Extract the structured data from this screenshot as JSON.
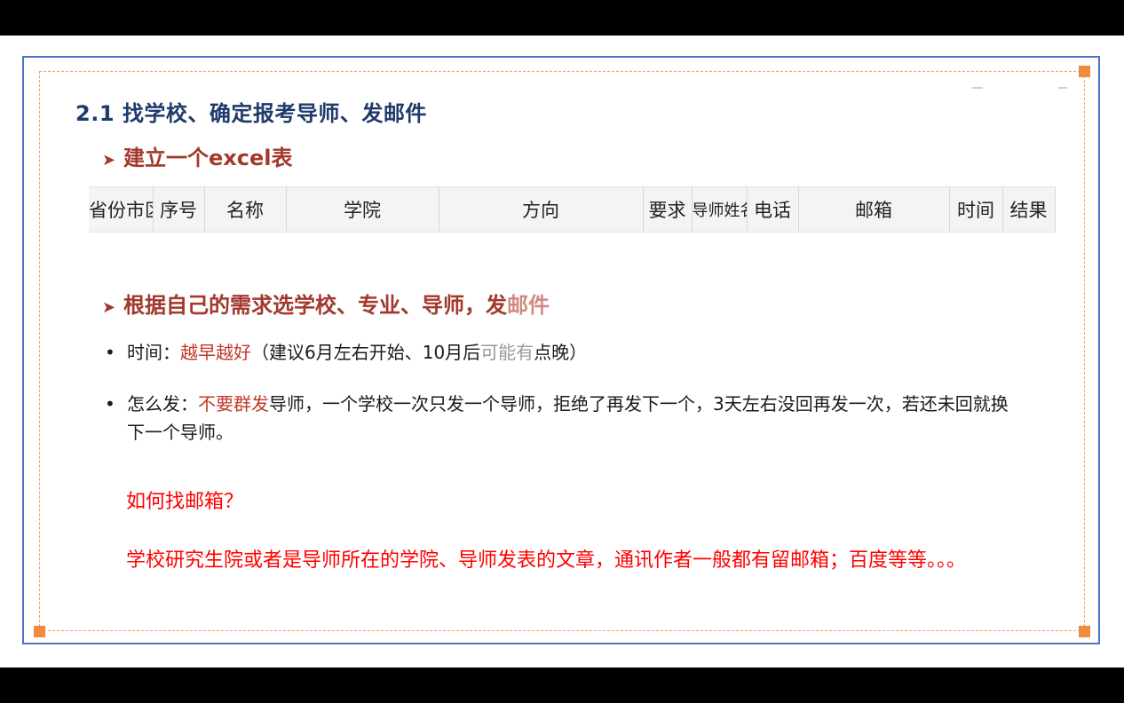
{
  "slide": {
    "title": "2.1 找学校、确定报考导师、发邮件",
    "subheading1": {
      "arrow": "➤",
      "text": "建立一个excel表"
    },
    "table_headers": [
      "省份市区",
      "序号",
      "名称",
      "学院",
      "方向",
      "要求",
      "导师姓名",
      "电话",
      "邮箱",
      "时间",
      "结果"
    ],
    "subheading2": {
      "arrow": "➤",
      "text_main": "根据自己的需求选学校、专业、导师，发",
      "text_faded": "邮件"
    },
    "bullets": [
      {
        "marker": "•",
        "parts": [
          "时间：",
          "越早越好",
          "（建议6月左右开始、10月后",
          "可能有",
          "点晚）"
        ]
      },
      {
        "marker": "•",
        "parts": [
          "怎么发：",
          "不要群发",
          "导师，一个学校一次只发一个导师，拒绝了再发下一个，3天左右没回再发一次，若还未回就换下一个导师。"
        ]
      }
    ],
    "note_question": "如何找邮箱？",
    "note_answer": "学校研究生院或者是导师所在的学院、导师发表的文章，通讯作者一般都有留邮箱；百度等等。。。"
  },
  "colors": {
    "frame_border": "#4a73c9",
    "selection_dash": "#f0a070",
    "handle": "#f08a3c",
    "title": "#1f3a6b",
    "subhead": "#a3382c",
    "emphasis": "#c0392b",
    "note": "#ff0000"
  }
}
